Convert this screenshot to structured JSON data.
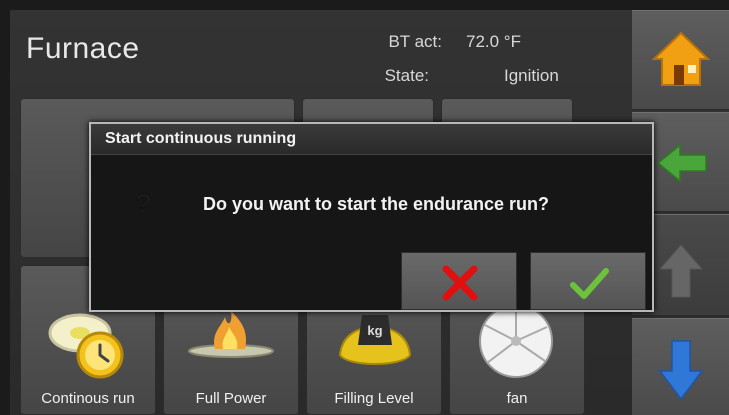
{
  "header": {
    "title": "Furnace",
    "bt_act_label": "BT act:",
    "bt_act_value": "72.0 °F",
    "state_label": "State:",
    "state_value": "Ignition"
  },
  "tiles": [
    {
      "label": "Continous run",
      "icon": "clock-icon"
    },
    {
      "label": "Full Power",
      "icon": "flame-icon"
    },
    {
      "label": "Filling Level",
      "icon": "weight-icon"
    },
    {
      "label": "fan",
      "icon": "fan-icon"
    }
  ],
  "side_buttons": [
    {
      "icon": "home-icon"
    },
    {
      "icon": "arrow-left-icon"
    },
    {
      "icon": "arrow-up-icon"
    },
    {
      "icon": "arrow-down-icon"
    }
  ],
  "dialog": {
    "title": "Start continuous running",
    "question_mark": "?",
    "message": "Do you want to start the endurance run?",
    "cancel_icon": "cross-icon",
    "confirm_icon": "checkmark-icon"
  },
  "colors": {
    "cancel_red": "#e01010",
    "confirm_green": "#6cc23a",
    "home_orange": "#f0a012",
    "back_green": "#4aa53a",
    "down_blue": "#2f78d8"
  }
}
